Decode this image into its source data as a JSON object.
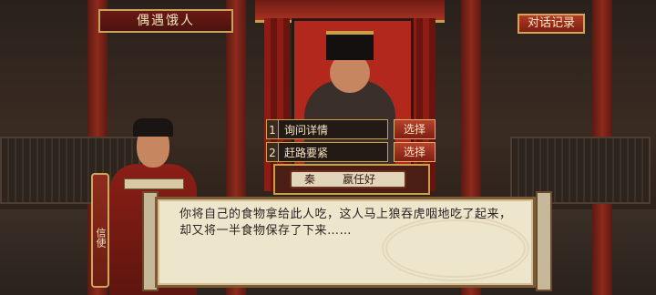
{
  "event_title": "偶遇饿人",
  "log_button_label": "对话记录",
  "choices": [
    {
      "number": "1",
      "label": "询问详情",
      "button": "选择"
    },
    {
      "number": "2",
      "label": "赶路要紧",
      "button": "选择"
    }
  ],
  "king_plate": {
    "title": "秦",
    "name": "嬴任好"
  },
  "speaker_name": "信使",
  "dialog_text": "你将自己的食物拿给此人吃，这人马上狼吞虎咽地吃了起来，却又将一半食物保存了下来……"
}
